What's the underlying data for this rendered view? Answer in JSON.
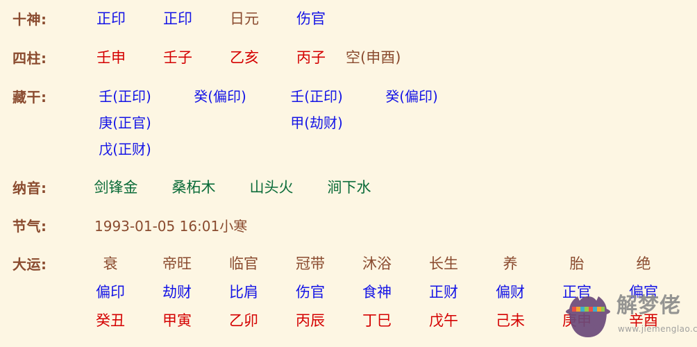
{
  "colors": {
    "background": "#fdf6e3",
    "label": "#8a4b2f",
    "blue": "#1414e6",
    "red": "#d40000",
    "green": "#0a6b38",
    "watermark_text": "#8c8c8c",
    "watermark_logo": "#6b4a7a"
  },
  "rows": {
    "ten_gods": {
      "label": "十神:",
      "values": [
        {
          "text": "正印",
          "color": "blue"
        },
        {
          "text": "正印",
          "color": "blue"
        },
        {
          "text": "日元",
          "color": "brown"
        },
        {
          "text": "伤官",
          "color": "blue"
        }
      ]
    },
    "four_pillars": {
      "label": "四柱:",
      "values": [
        {
          "text": "壬申",
          "color": "red"
        },
        {
          "text": "壬子",
          "color": "red"
        },
        {
          "text": "乙亥",
          "color": "red"
        },
        {
          "text": "丙子",
          "color": "red"
        }
      ],
      "void": "空(申酉)"
    },
    "hidden_stems": {
      "label": "藏干:",
      "columns": [
        [
          "壬(正印)",
          "庚(正官)",
          "戊(正财)"
        ],
        [
          "癸(偏印)"
        ],
        [
          "壬(正印)",
          "甲(劫财)"
        ],
        [
          "癸(偏印)"
        ]
      ]
    },
    "nayin": {
      "label": "纳音:",
      "values": [
        "剑锋金",
        "桑柘木",
        "山头火",
        "涧下水"
      ]
    },
    "solar_term": {
      "label": "节气:",
      "value": "1993-01-05 16:01小寒"
    },
    "luck_cycles": {
      "label": "大运:",
      "stages": [
        "衰",
        "帝旺",
        "临官",
        "冠带",
        "沐浴",
        "长生",
        "养",
        "胎",
        "绝"
      ],
      "gods": [
        "偏印",
        "劫财",
        "比肩",
        "伤官",
        "食神",
        "正财",
        "偏财",
        "正官",
        "偏官"
      ],
      "pillars": [
        "癸丑",
        "甲寅",
        "乙卯",
        "丙辰",
        "丁巳",
        "戊午",
        "己未",
        "庚申",
        "辛酉"
      ]
    }
  },
  "watermark": {
    "brand": "解梦佬",
    "url": "www.jiemenglao.com"
  }
}
